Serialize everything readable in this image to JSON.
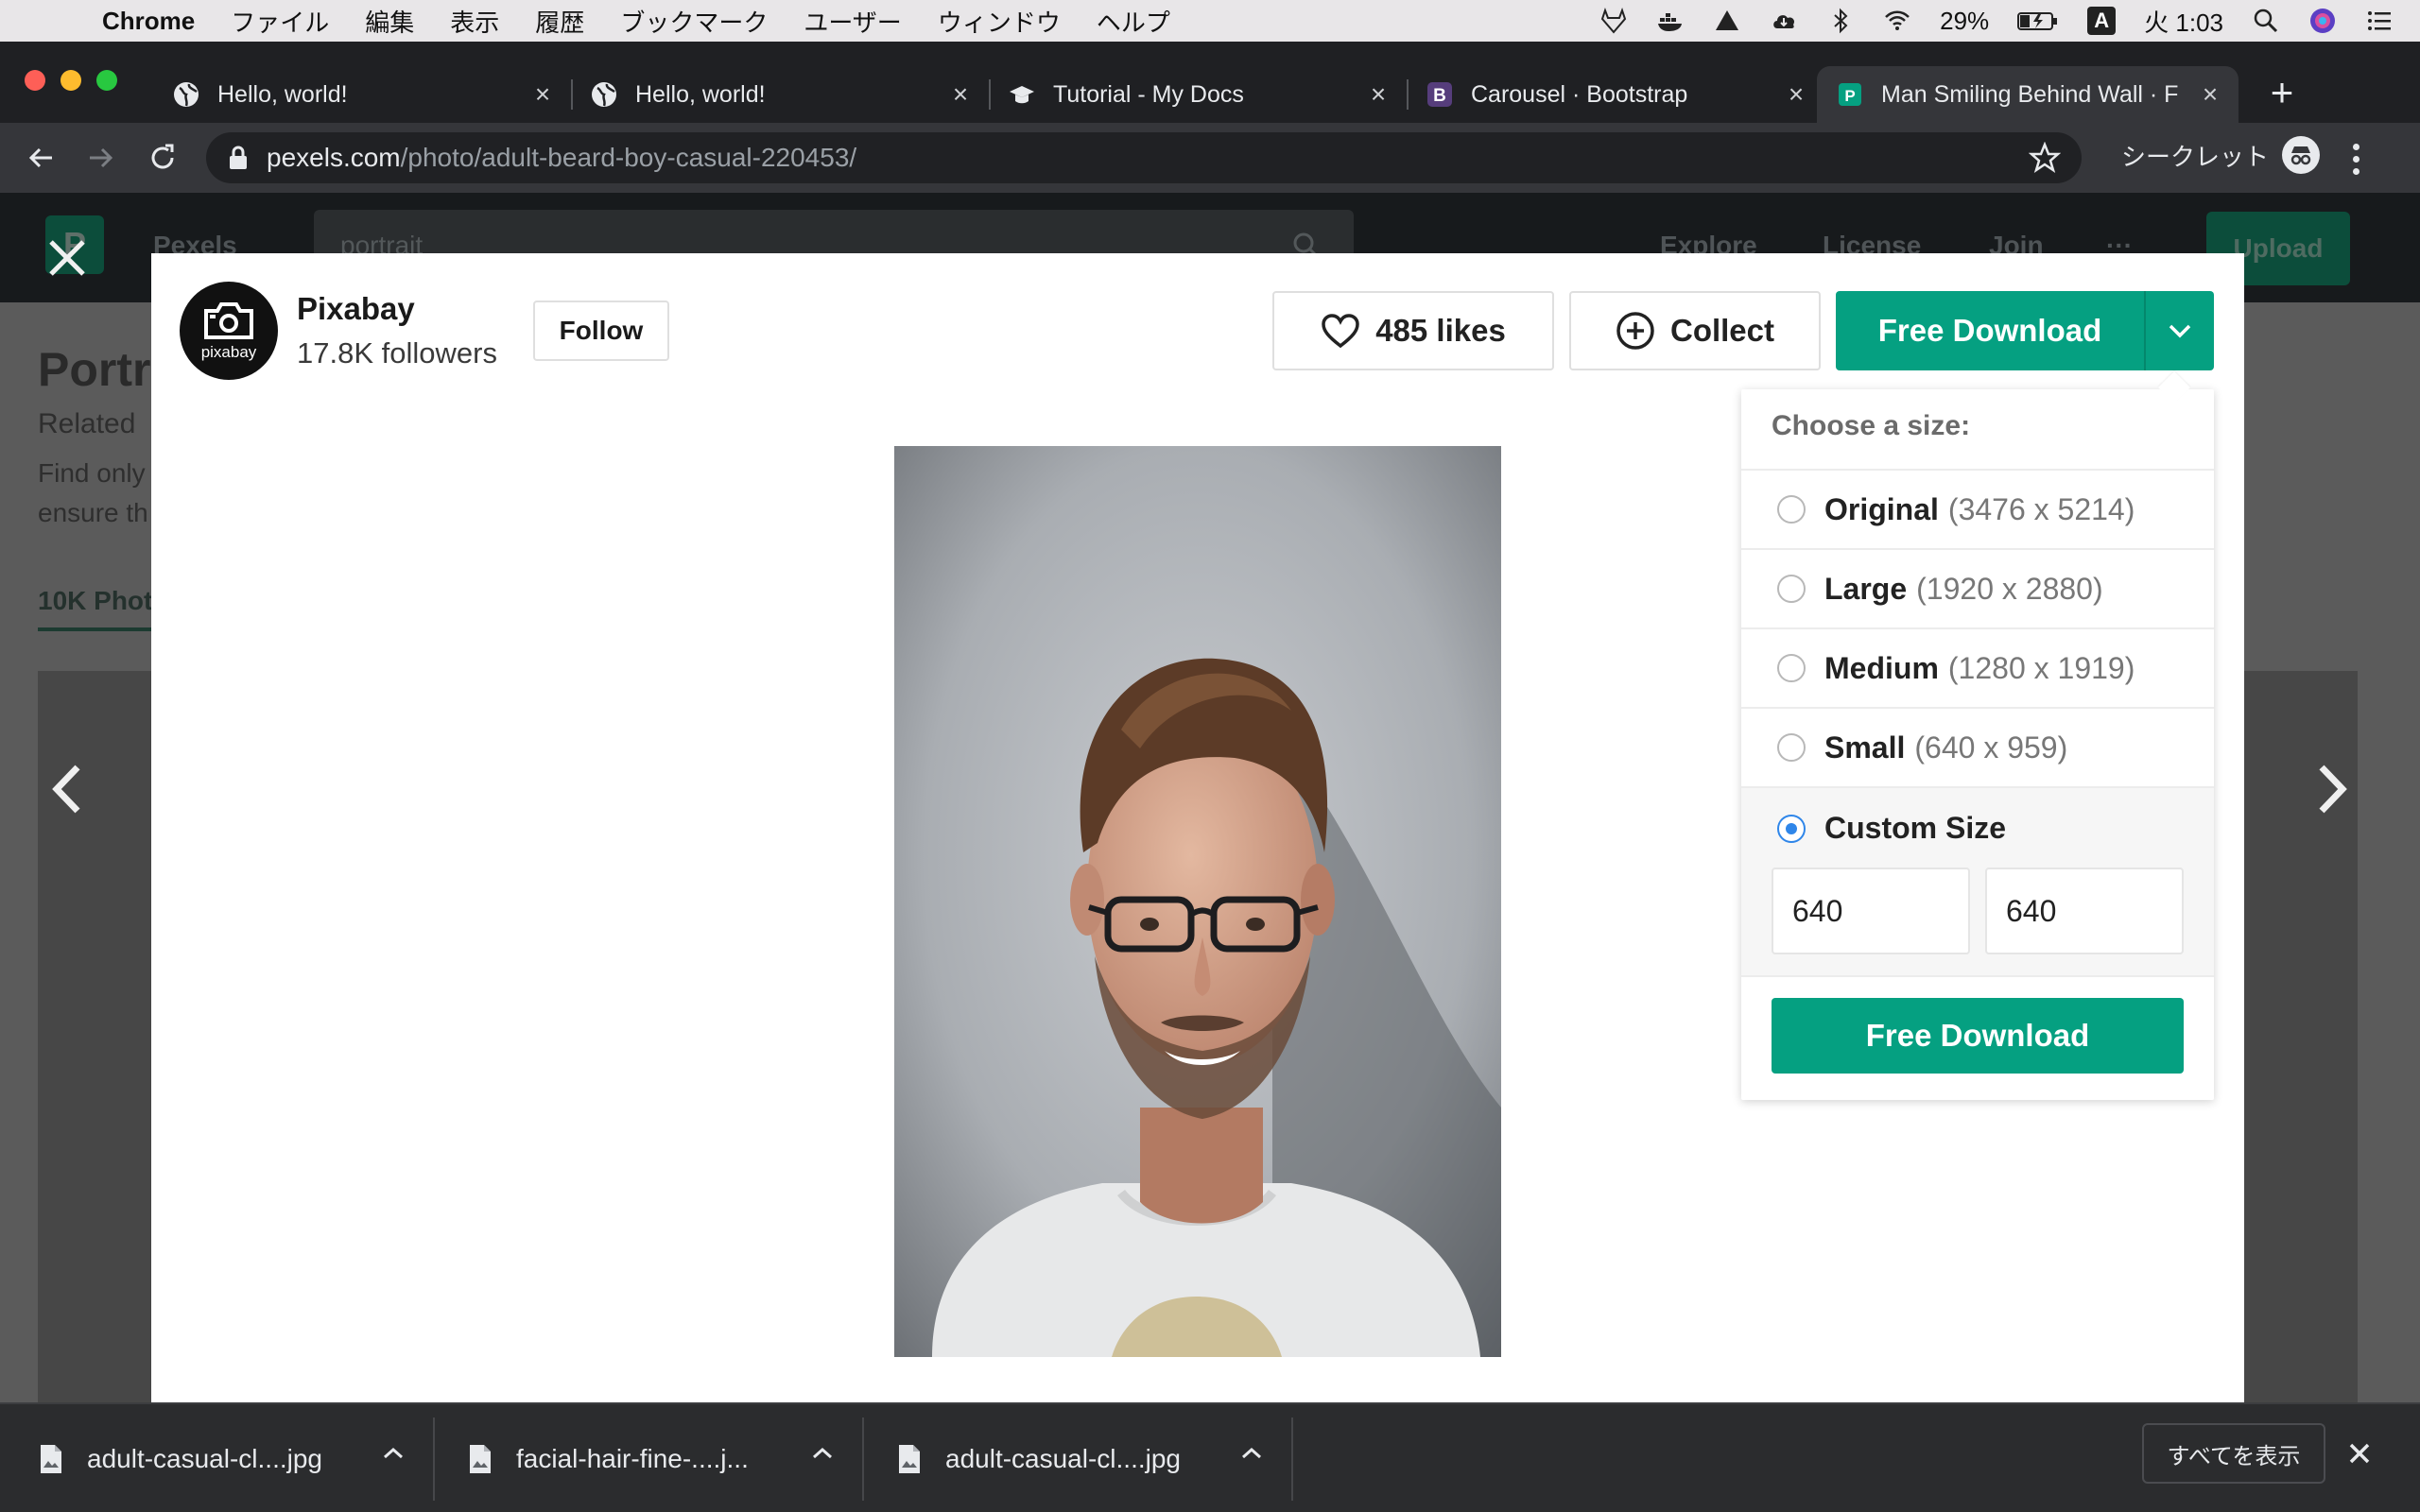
{
  "menubar": {
    "app_name": "Chrome",
    "items": [
      "ファイル",
      "編集",
      "表示",
      "履歴",
      "ブックマーク",
      "ユーザー",
      "ウィンドウ",
      "ヘルプ"
    ],
    "battery": "29%",
    "input_mode": "A",
    "clock": "火 1:03"
  },
  "tabs": [
    {
      "title": "Hello, world!",
      "icon": "globe-icon"
    },
    {
      "title": "Hello, world!",
      "icon": "globe-icon"
    },
    {
      "title": "Tutorial - My Docs",
      "icon": "graduation-cap-icon"
    },
    {
      "title": "Carousel · Bootstrap",
      "icon": "bootstrap-icon"
    },
    {
      "title": "Man Smiling Behind Wall · F",
      "icon": "pexels-icon",
      "active": true
    }
  ],
  "address": {
    "host": "pexels.com",
    "path": "/photo/adult-beard-boy-casual-220453/"
  },
  "incognito_label": "シークレット",
  "background_page": {
    "logo_letter": "P",
    "brand": "Pexels",
    "search_value": "portrait",
    "nav": [
      "Explore",
      "License",
      "Join",
      "···"
    ],
    "upload": "Upload",
    "title": "Portra",
    "related": "Related",
    "desc_line1": "Find only",
    "desc_line2": "ensure th",
    "count_tab": "10K Phot"
  },
  "modal": {
    "author": {
      "avatar_text": "pixabay",
      "name": "Pixabay",
      "followers": "17.8K followers"
    },
    "follow_label": "Follow",
    "likes_label": "485 likes",
    "collect_label": "Collect",
    "download_label": "Free Download",
    "photo_alt": "Man Smiling Behind Wall"
  },
  "size_menu": {
    "heading": "Choose a size:",
    "options": [
      {
        "name": "Original",
        "dims": "(3476 x 5214)",
        "selected": false
      },
      {
        "name": "Large",
        "dims": "(1920 x 2880)",
        "selected": false
      },
      {
        "name": "Medium",
        "dims": "(1280 x 1919)",
        "selected": false
      },
      {
        "name": "Small",
        "dims": "(640 x 959)",
        "selected": false
      }
    ],
    "custom": {
      "name": "Custom Size",
      "selected": true,
      "width": "640",
      "height": "640"
    },
    "download_label": "Free Download"
  },
  "downloads": [
    {
      "filename": "adult-casual-cl....jpg"
    },
    {
      "filename": "facial-hair-fine-....j..."
    },
    {
      "filename": "adult-casual-cl....jpg"
    }
  ],
  "show_all_label": "すべてを表示",
  "colors": {
    "accent_green": "#05a081",
    "radio_blue": "#2f86e9"
  }
}
